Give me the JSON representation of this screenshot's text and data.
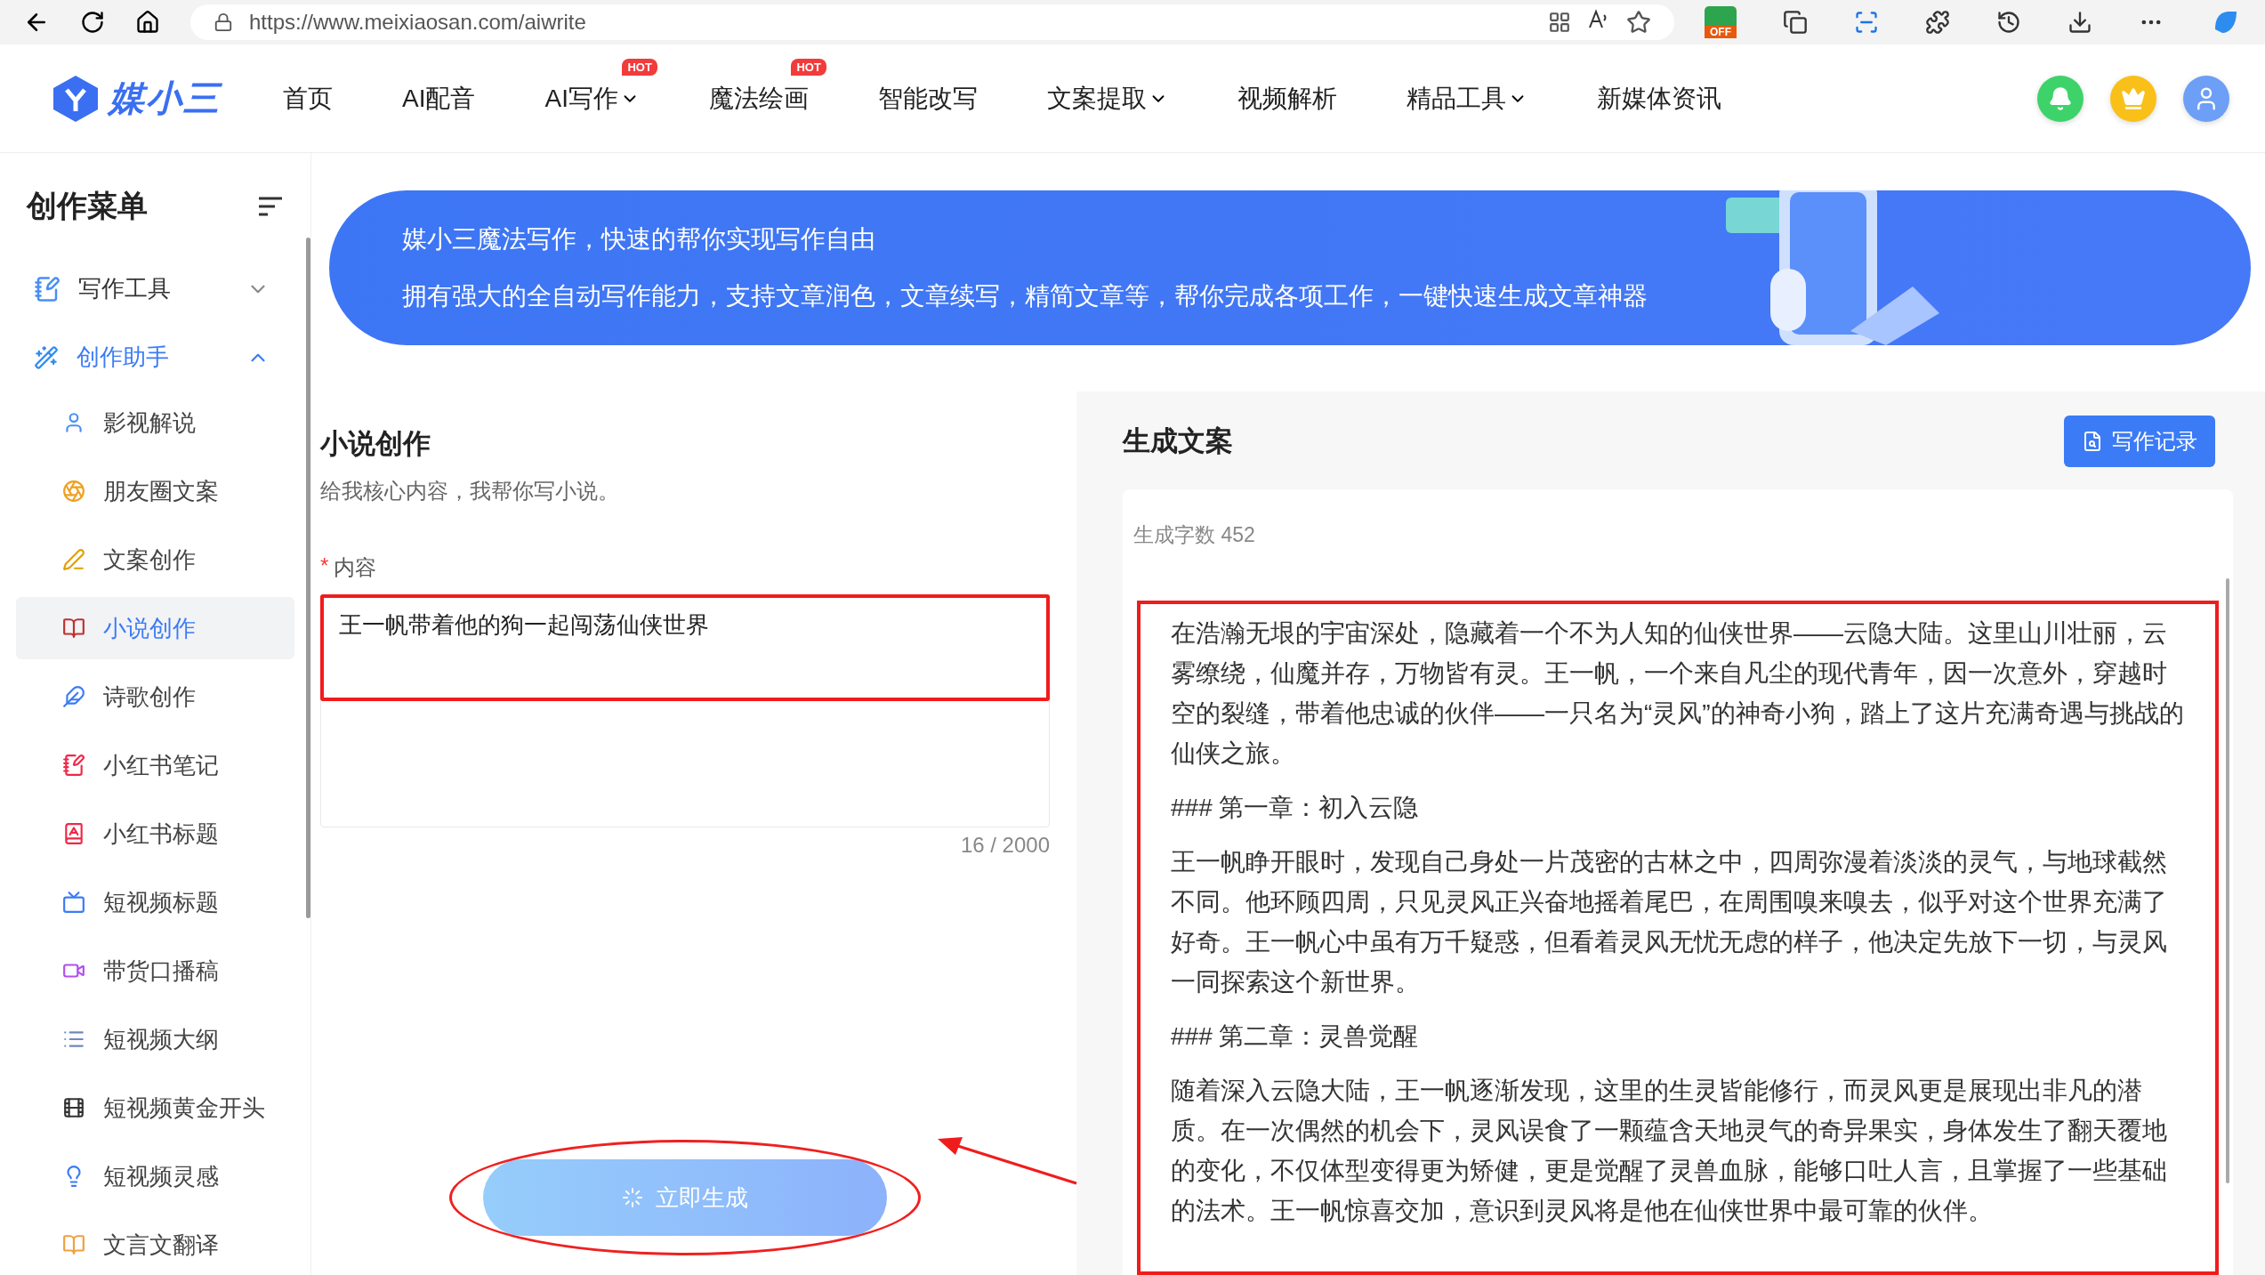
{
  "browser": {
    "url": "https://www.meixiaosan.com/aiwrite",
    "extension_badge": "OFF"
  },
  "nav": {
    "logo": "媒小三",
    "items": [
      {
        "label": "首页",
        "dropdown": false
      },
      {
        "label": "AI配音",
        "dropdown": false
      },
      {
        "label": "AI写作",
        "badge": "HOT",
        "dropdown": true
      },
      {
        "label": "魔法绘画",
        "badge": "HOT",
        "dropdown": false
      },
      {
        "label": "智能改写",
        "dropdown": false
      },
      {
        "label": "文案提取",
        "dropdown": true
      },
      {
        "label": "视频解析",
        "dropdown": false
      },
      {
        "label": "精品工具",
        "dropdown": true
      },
      {
        "label": "新媒体资讯",
        "dropdown": false
      }
    ]
  },
  "sidebar": {
    "title": "创作菜单",
    "groups": [
      {
        "label": "写作工具",
        "expanded": false
      },
      {
        "label": "创作助手",
        "expanded": true,
        "children": [
          {
            "label": "影视解说",
            "selected": false
          },
          {
            "label": "朋友圈文案",
            "selected": false
          },
          {
            "label": "文案创作",
            "selected": false
          },
          {
            "label": "小说创作",
            "selected": true
          },
          {
            "label": "诗歌创作",
            "selected": false
          },
          {
            "label": "小红书笔记",
            "selected": false
          },
          {
            "label": "小红书标题",
            "selected": false
          },
          {
            "label": "短视频标题",
            "selected": false
          },
          {
            "label": "带货口播稿",
            "selected": false
          },
          {
            "label": "短视频大纲",
            "selected": false
          },
          {
            "label": "短视频黄金开头",
            "selected": false
          },
          {
            "label": "短视频灵感",
            "selected": false
          },
          {
            "label": "文言文翻译",
            "selected": false
          }
        ]
      }
    ]
  },
  "banner": {
    "headline": "媒小三魔法写作，快速的帮你实现写作自由",
    "description": "拥有强大的全自动写作能力，支持文章润色，文章续写，精简文章等，帮你完成各项工作，一键快速生成文章神器"
  },
  "form": {
    "title": "小说创作",
    "subtitle": "给我核心内容，我帮你写小说。",
    "required_mark": "*",
    "field_label": "内容",
    "value": "王一帆带着他的狗一起闯荡仙侠世界",
    "counter": "16 / 2000",
    "button": "立即生成",
    "loading": true
  },
  "output": {
    "title": "生成文案",
    "history_button": "写作记录",
    "word_count": "生成字数 452",
    "paragraphs": [
      "在浩瀚无垠的宇宙深处，隐藏着一个不为人知的仙侠世界——云隐大陆。这里山川壮丽，云雾缭绕，仙魔并存，万物皆有灵。王一帆，一个来自凡尘的现代青年，因一次意外，穿越时空的裂缝，带着他忠诚的伙伴——一只名为“灵风”的神奇小狗，踏上了这片充满奇遇与挑战的仙侠之旅。",
      "### 第一章：初入云隐",
      "王一帆睁开眼时，发现自己身处一片茂密的古林之中，四周弥漫着淡淡的灵气，与地球截然不同。他环顾四周，只见灵风正兴奋地摇着尾巴，在周围嗅来嗅去，似乎对这个世界充满了好奇。王一帆心中虽有万千疑惑，但看着灵风无忧无虑的样子，他决定先放下一切，与灵风一同探索这个新世界。",
      "### 第二章：灵兽觉醒",
      "随着深入云隐大陆，王一帆逐渐发现，这里的生灵皆能修行，而灵风更是展现出非凡的潜质。在一次偶然的机会下，灵风误食了一颗蕴含天地灵气的奇异果实，身体发生了翻天覆地的变化，不仅体型变得更为矫健，更是觉醒了灵兽血脉，能够口吐人言，且掌握了一些基础的法术。王一帆惊喜交加，意识到灵风将是他在仙侠世界中最可靠的伙伴。"
    ]
  }
}
